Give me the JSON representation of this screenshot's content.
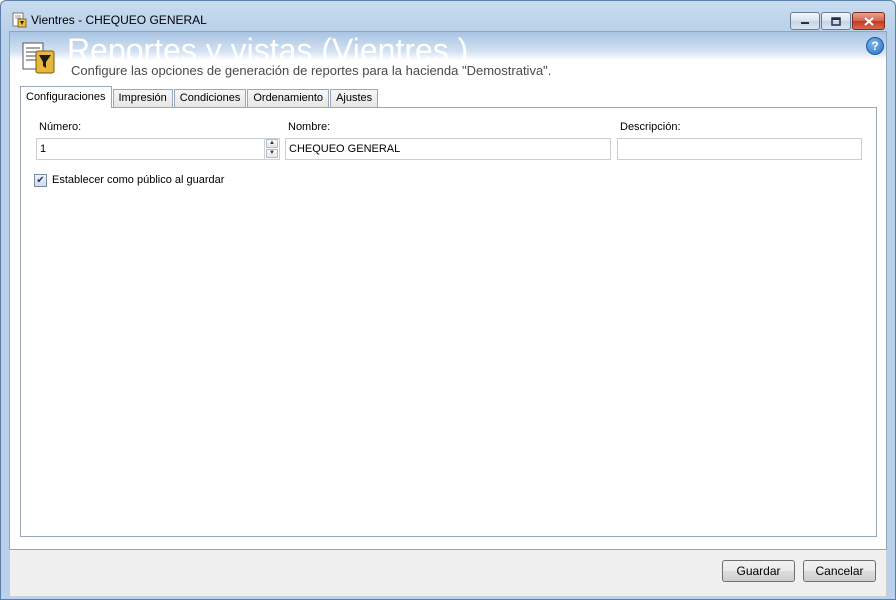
{
  "window": {
    "title": "Vientres  - CHEQUEO GENERAL",
    "minimize_icon": "minimize-icon",
    "maximize_icon": "maximize-icon",
    "close_icon": "close-icon"
  },
  "header": {
    "title": "Reportes y vistas (Vientres )",
    "subtitle": "Configure las opciones de generación de reportes para la hacienda \"Demostrativa\".",
    "icon": "report-filter-icon",
    "help": "?"
  },
  "tabs": [
    {
      "label": "Configuraciones",
      "active": true
    },
    {
      "label": "Impresión",
      "active": false
    },
    {
      "label": "Condiciones",
      "active": false
    },
    {
      "label": "Ordenamiento",
      "active": false
    },
    {
      "label": "Ajustes",
      "active": false
    }
  ],
  "form": {
    "numero_label": "Número:",
    "numero_value": "1",
    "nombre_label": "Nombre:",
    "nombre_value": "CHEQUEO GENERAL",
    "descripcion_label": "Descripción:",
    "descripcion_value": "",
    "public_label": "Establecer como público al guardar",
    "public_checked": true
  },
  "footer": {
    "save_label": "Guardar",
    "cancel_label": "Cancelar"
  },
  "colors": {
    "frame": "#b9d1ea",
    "close": "#c2391f",
    "help": "#2a6fc4"
  }
}
